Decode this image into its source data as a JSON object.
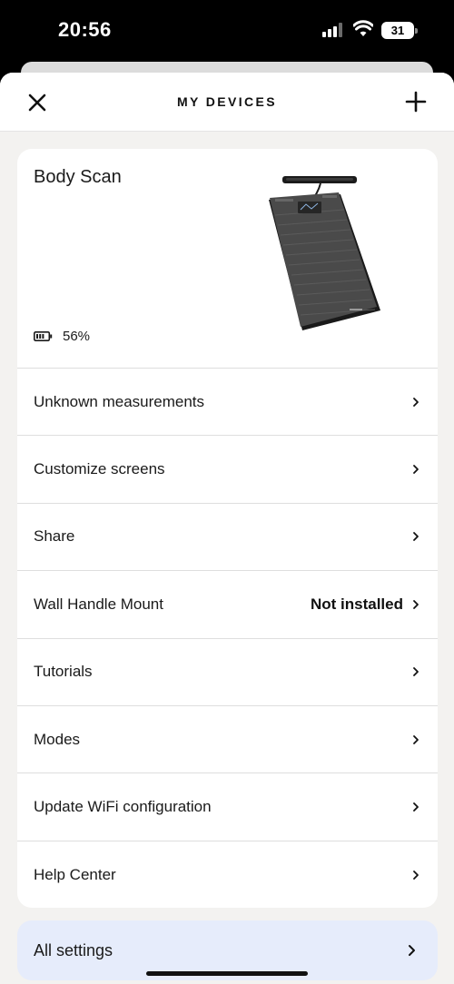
{
  "status_bar": {
    "time": "20:56",
    "battery_level": "31",
    "signal_icon": "cellular-signal-icon",
    "wifi_icon": "wifi-icon"
  },
  "header": {
    "title": "MY DEVICES",
    "close_icon": "close-icon",
    "add_icon": "plus-icon"
  },
  "device": {
    "name": "Body Scan",
    "battery_percent": "56%",
    "battery_icon": "battery-icon",
    "image_icon": "smart-scale-image"
  },
  "menu": {
    "items": [
      {
        "label": "Unknown measurements",
        "value": ""
      },
      {
        "label": "Customize screens",
        "value": ""
      },
      {
        "label": "Share",
        "value": ""
      },
      {
        "label": "Wall Handle Mount",
        "value": "Not installed"
      },
      {
        "label": "Tutorials",
        "value": ""
      },
      {
        "label": "Modes",
        "value": ""
      },
      {
        "label": "Update WiFi configuration",
        "value": ""
      },
      {
        "label": "Help Center",
        "value": ""
      }
    ]
  },
  "all_settings": {
    "label": "All settings"
  },
  "colors": {
    "background": "#f3f2f0",
    "card": "#ffffff",
    "all_settings_bg": "#e6ecfb",
    "text": "#1a1a1a"
  }
}
